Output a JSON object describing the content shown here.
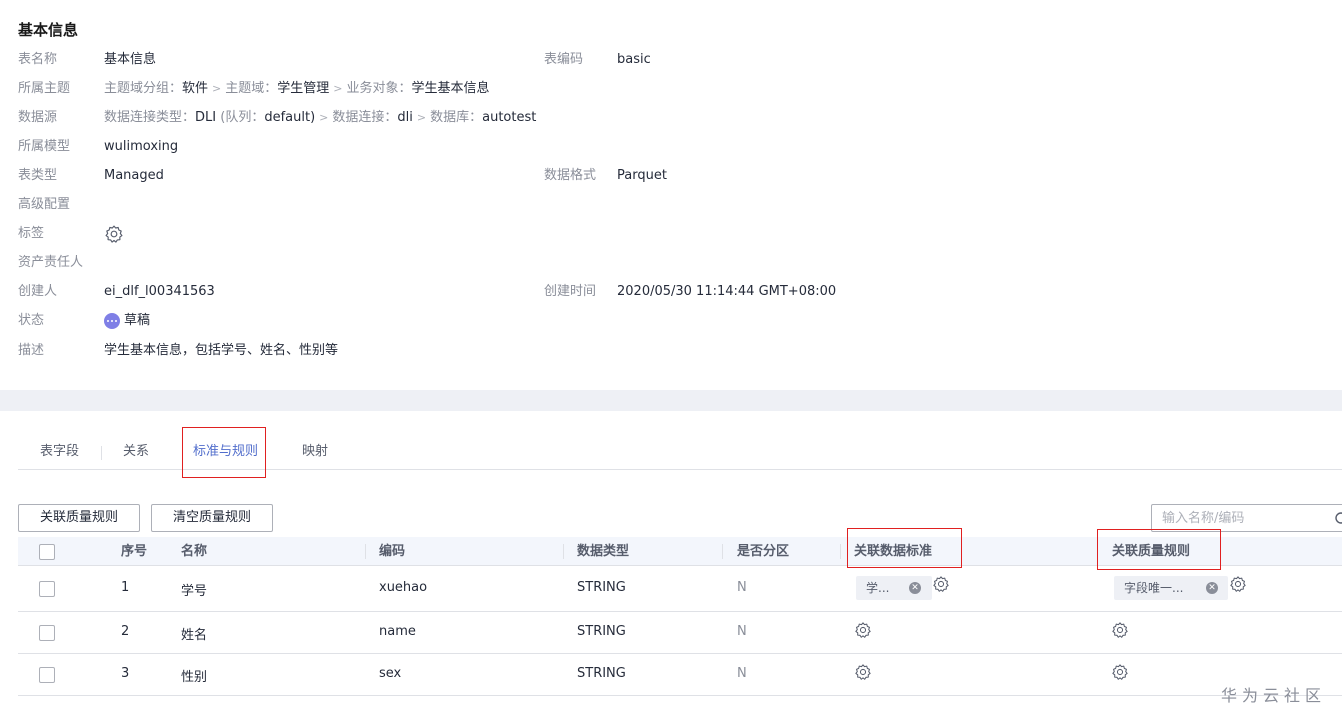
{
  "info": {
    "title": "基本信息",
    "table_name_label": "表名称",
    "table_name_value": "基本信息",
    "table_code_label": "表编码",
    "table_code_value": "basic",
    "topic_label": "所属主题",
    "topic": {
      "group_label": "主题域分组：",
      "group_value": "软件",
      "domain_label": "主题域：",
      "domain_value": "学生管理",
      "object_label": "业务对象：",
      "object_value": "学生基本信息"
    },
    "datasource_label": "数据源",
    "datasource": {
      "conn_type_label": "数据连接类型：",
      "conn_type_value": "DLI",
      "queue_open": " (队列：",
      "queue_value": "default)",
      "conn_label": "数据连接：",
      "conn_value": "dli",
      "db_label": "数据库：",
      "db_value": "autotest"
    },
    "separator": ">",
    "model_label": "所属模型",
    "model_value": "wulimoxing",
    "table_type_label": "表类型",
    "table_type_value": "Managed",
    "data_format_label": "数据格式",
    "data_format_value": "Parquet",
    "advanced_label": "高级配置",
    "tags_label": "标签",
    "owner_label": "资产责任人",
    "creator_label": "创建人",
    "creator_value": "ei_dlf_l00341563",
    "created_time_label": "创建时间",
    "created_time_value": "2020/05/30 11:14:44 GMT+08:00",
    "status_label": "状态",
    "status_value": "草稿",
    "status_color": "#7f7fe6",
    "description_label": "描述",
    "description_value": "学生基本信息，包括学号、姓名、性别等"
  },
  "tabs": [
    {
      "label": "表字段"
    },
    {
      "label": "关系"
    },
    {
      "label": "标准与规则",
      "active": true
    },
    {
      "label": "映射"
    }
  ],
  "toolbar": {
    "link_rule_label": "关联质量规则",
    "clear_rule_label": "清空质量规则",
    "search_placeholder": "输入名称/编码"
  },
  "table": {
    "headers": {
      "index": "序号",
      "name": "名称",
      "code": "编码",
      "data_type": "数据类型",
      "partition": "是否分区",
      "standard": "关联数据标准",
      "quality_rule": "关联质量规则"
    },
    "rows": [
      {
        "index": "1",
        "name": "学号",
        "code": "xuehao",
        "data_type": "STRING",
        "partition": "N",
        "standard_chip": "学...",
        "rule_chip": "字段唯一..."
      },
      {
        "index": "2",
        "name": "姓名",
        "code": "name",
        "data_type": "STRING",
        "partition": "N",
        "standard_chip": "",
        "rule_chip": ""
      },
      {
        "index": "3",
        "name": "性别",
        "code": "sex",
        "data_type": "STRING",
        "partition": "N",
        "standard_chip": "",
        "rule_chip": ""
      }
    ]
  },
  "watermark": "华为云社区",
  "colors": {
    "accent": "#526ecc",
    "highlight_box": "#e02020",
    "section_band": "#eef0f5"
  }
}
